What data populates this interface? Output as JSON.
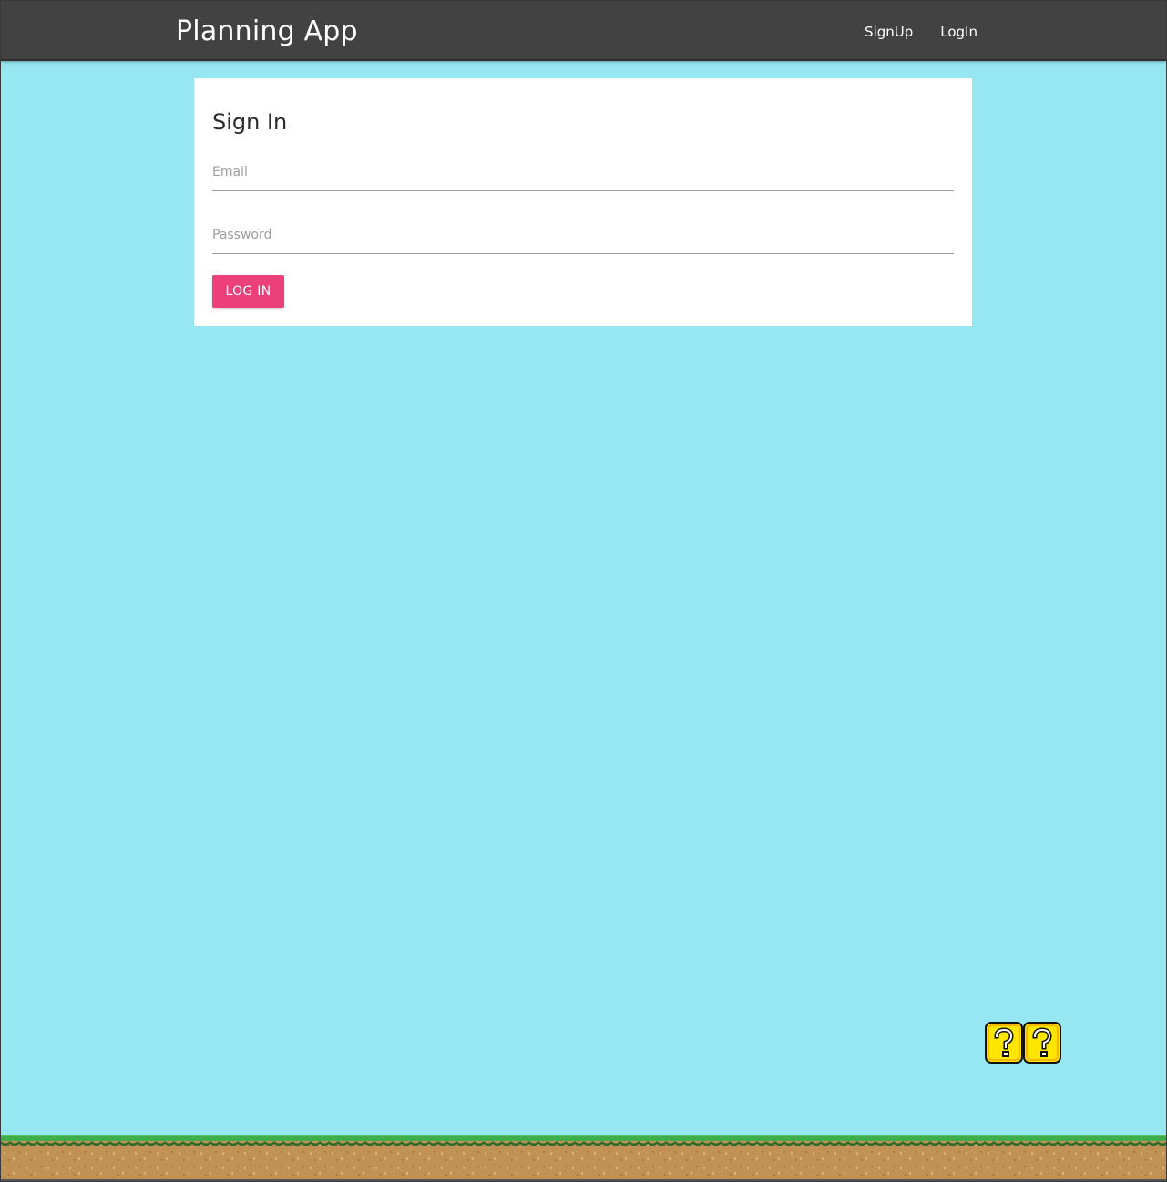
{
  "navbar": {
    "brand": "Planning App",
    "links": [
      {
        "label": "SignUp"
      },
      {
        "label": "LogIn"
      }
    ]
  },
  "signin": {
    "title": "Sign In",
    "email_placeholder": "Email",
    "password_placeholder": "Password",
    "submit_label": "LOG IN"
  },
  "colors": {
    "navbar_bg": "#424242",
    "page_bg": "#97e7f2",
    "button_bg": "#ec407a",
    "grass": "#3fae4a",
    "dirt": "#c09255",
    "block_yellow": "#ffe600"
  },
  "decorations": {
    "blocks": [
      "question-block-icon",
      "question-block-icon"
    ],
    "ground": "grass-ground"
  }
}
